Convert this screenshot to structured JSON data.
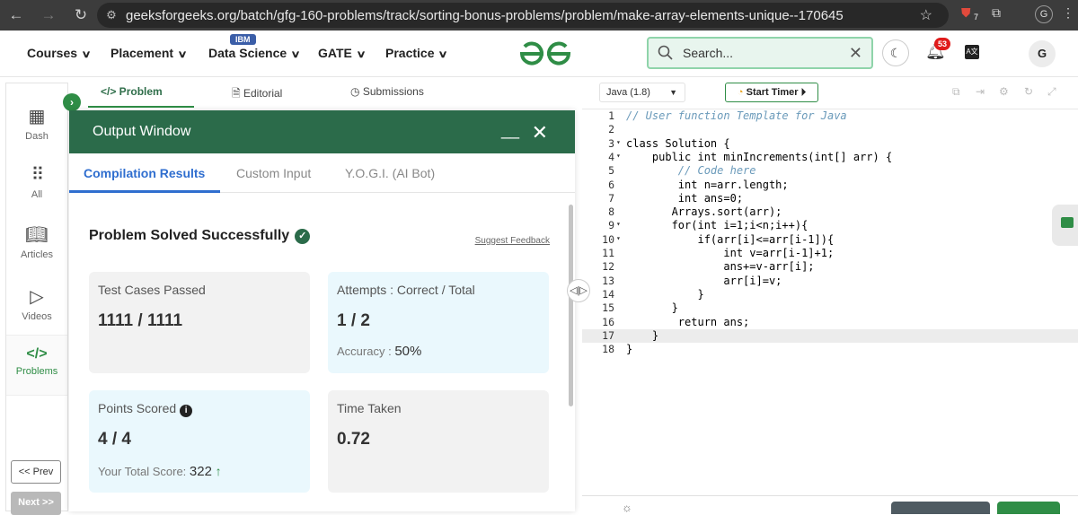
{
  "browser": {
    "url": "geeksforgeeks.org/batch/gfg-160-problems/track/sorting-bonus-problems/problem/make-array-elements-unique--170645",
    "ext_badge": "7",
    "profile_initial": "G"
  },
  "header": {
    "menu": [
      "Courses",
      "Placement",
      "Data Science",
      "GATE",
      "Practice"
    ],
    "ibm_badge": "IBM",
    "logo_text": "GfG",
    "search_placeholder": "Search...",
    "notification_count": "53",
    "user_initial": "G"
  },
  "sidebar": {
    "items": [
      {
        "label": "Dash",
        "icon": "dashboard-icon"
      },
      {
        "label": "All",
        "icon": "grid-icon"
      },
      {
        "label": "Articles",
        "icon": "book-icon"
      },
      {
        "label": "Videos",
        "icon": "play-icon"
      },
      {
        "label": "Problems",
        "icon": "code-icon"
      }
    ],
    "prev_label": "<< Prev",
    "next_label": "Next >>"
  },
  "problem_tabs": {
    "problem": "</> Problem",
    "editorial": "Editorial",
    "submissions": "Submissions"
  },
  "output": {
    "title": "Output Window",
    "tabs": [
      "Compilation Results",
      "Custom Input",
      "Y.O.G.I. (AI Bot)"
    ],
    "status": "Problem Solved Successfully",
    "feedback": "Suggest Feedback",
    "test_cases_label": "Test Cases Passed",
    "test_cases_value": "1111 / 1111",
    "attempts_label": "Attempts : Correct / Total",
    "attempts_value": "1 / 2",
    "accuracy_label": "Accuracy :",
    "accuracy_value": "50%",
    "points_label": "Points Scored",
    "points_value": "4 / 4",
    "total_score_label": "Your Total Score:",
    "total_score_value": "322",
    "time_label": "Time Taken",
    "time_value": "0.72"
  },
  "editor": {
    "language": "Java (1.8)",
    "timer_label": "Start Timer",
    "line_numbers": [
      "1",
      "2",
      "3",
      "4",
      "5",
      "6",
      "7",
      "8",
      "9",
      "10",
      "11",
      "12",
      "13",
      "14",
      "15",
      "16",
      "17",
      "18"
    ],
    "lines": [
      "// User function Template for Java",
      "",
      "class Solution {",
      "    public int minIncrements(int[] arr) {",
      "        // Code here",
      "        int n=arr.length;",
      "        int ans=0;",
      "       Arrays.sort(arr);",
      "       for(int i=1;i<n;i++){",
      "           if(arr[i]<=arr[i-1]){",
      "               int v=arr[i-1]+1;",
      "               ans+=v-arr[i];",
      "               arr[i]=v;",
      "           }",
      "       }",
      "        return ans;",
      "    }",
      "}"
    ]
  },
  "colors": {
    "brand_green": "#2f8d46",
    "window_header": "#2b6b4a",
    "tab_blue": "#2f6ecf",
    "card_blue": "#eaf8fd",
    "card_gray": "#f2f2f2"
  }
}
